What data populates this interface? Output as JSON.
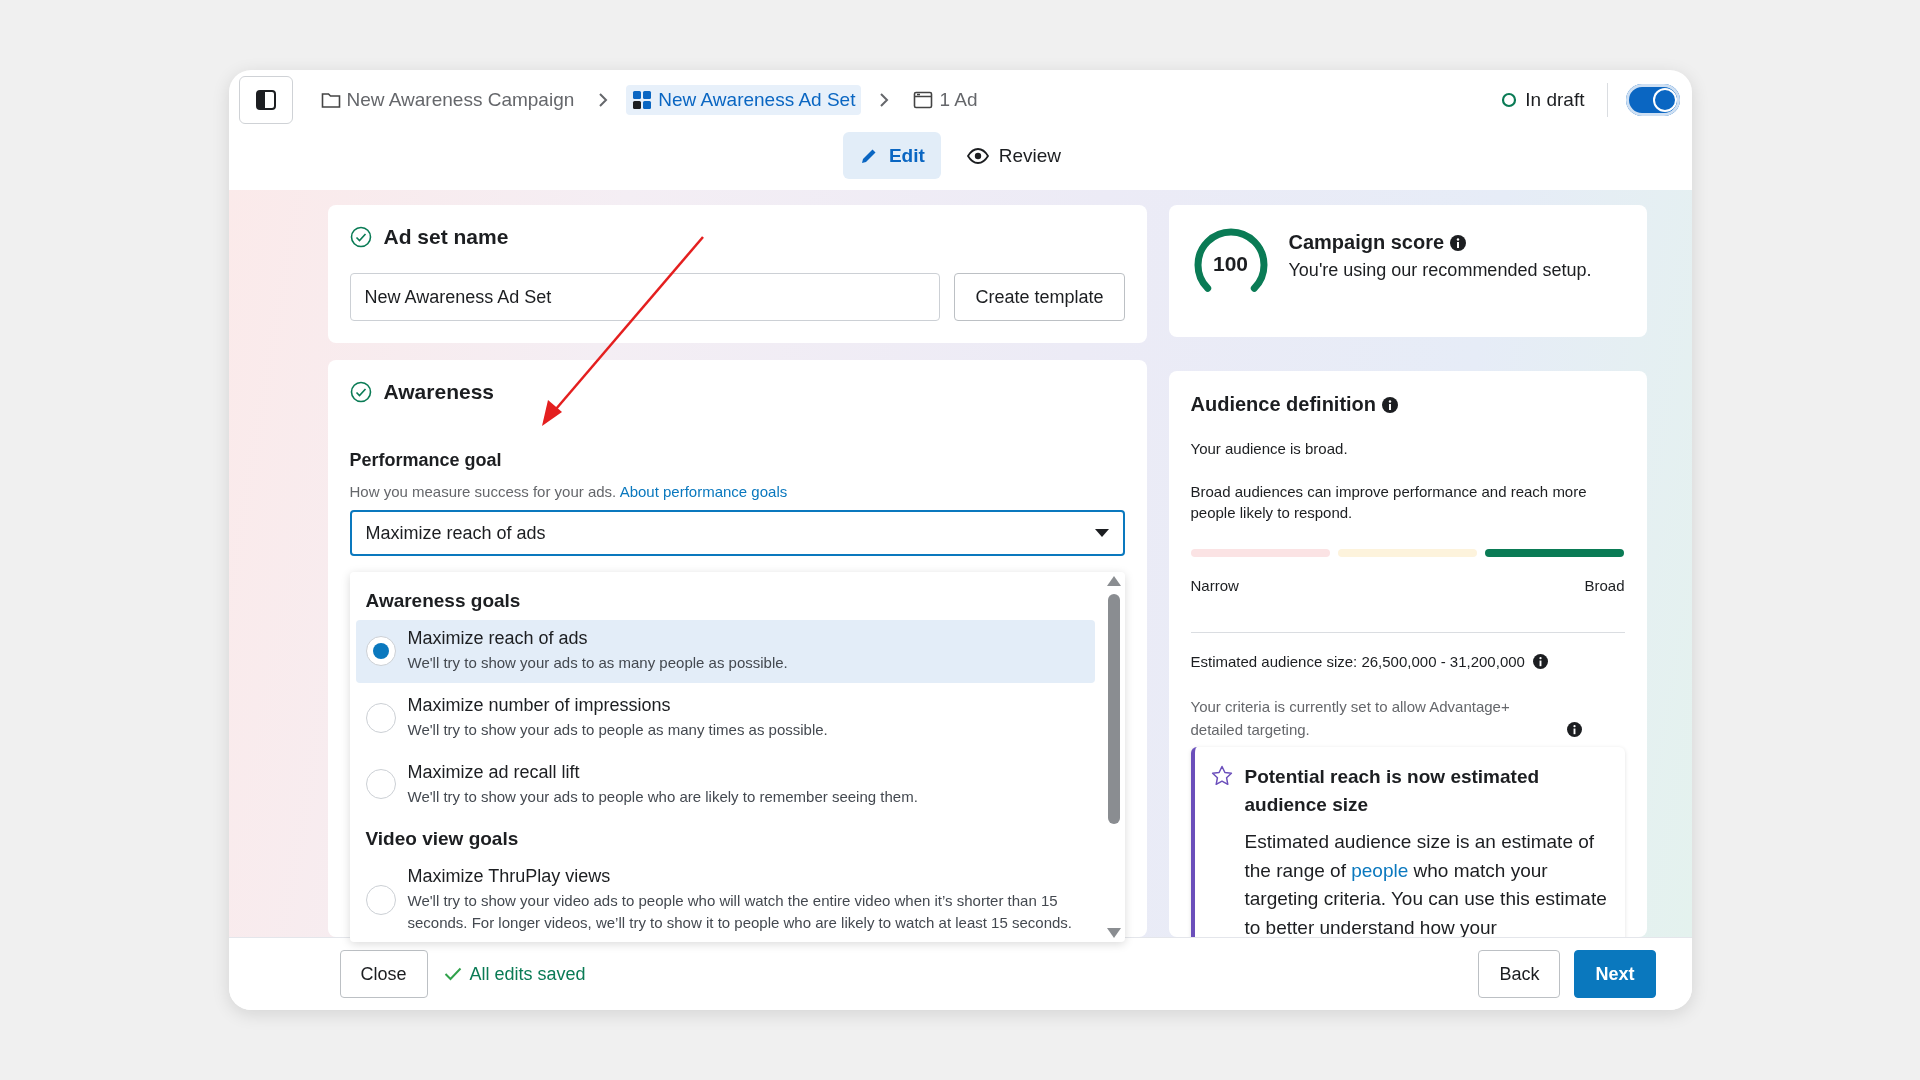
{
  "header": {
    "breadcrumbs": [
      {
        "label": "New Awareness Campaign",
        "kind": "folder",
        "selected": false
      },
      {
        "label": "New Awareness Ad Set",
        "kind": "adset",
        "selected": true
      },
      {
        "label": "1 Ad",
        "kind": "ad",
        "selected": false
      }
    ],
    "status": "In draft",
    "toggle": {
      "on": true
    }
  },
  "tabs": [
    {
      "label": "Edit",
      "kind": "edit",
      "selected": true
    },
    {
      "label": "Review",
      "kind": "review",
      "selected": false
    }
  ],
  "ad_set_name": {
    "title": "Ad set name",
    "complete": true,
    "value": "New Awareness Ad Set",
    "button": "Create template"
  },
  "objective": {
    "title": "Awareness",
    "complete": true,
    "performance_goal": {
      "label": "Performance goal",
      "hint": "How you measure success for your ads.",
      "link": "About performance goals",
      "value": "Maximize reach of ads"
    }
  },
  "goal_menu": {
    "groups": [
      {
        "title": "Awareness goals",
        "options": [
          {
            "title": "Maximize reach of ads",
            "description": "We'll try to show your ads to as many people as possible.",
            "selected": true
          },
          {
            "title": "Maximize number of impressions",
            "description": "We'll try to show your ads to people as many times as possible.",
            "selected": false
          },
          {
            "title": "Maximize ad recall lift",
            "description": "We'll try to show your ads to people who are likely to remember seeing them.",
            "selected": false
          }
        ]
      },
      {
        "title": "Video view goals",
        "options": [
          {
            "title": "Maximize ThruPlay views",
            "description": "We'll try to show your video ads to people who will watch the entire video when it’s shorter than 15 seconds. For longer videos, we’ll try to show it to people who are likely to watch at least 15 seconds.",
            "selected": false
          }
        ]
      }
    ]
  },
  "campaign_score": {
    "score": "100",
    "title": "Campaign score",
    "text": "You're using our recommended setup."
  },
  "audience": {
    "title": "Audience definition",
    "status": "Your audience is broad.",
    "text": "Broad audiences can improve performance and reach more people likely to respond.",
    "meter": [
      {
        "selected": false
      },
      {
        "selected": false
      },
      {
        "selected": true
      }
    ],
    "min_label": "Narrow",
    "max_label": "Broad",
    "estimate": "Estimated audience size: 26,500,000 - 31,200,000",
    "criteria": "Your criteria is currently set to allow Advantage+ detailed targeting.",
    "notice": {
      "title": "Potential reach is now estimated audience size",
      "text_before": "Estimated audience size is an estimate of the range of",
      "link": "people",
      "text_after": "who match your targeting criteria. You can use this estimate to better understand how your"
    }
  },
  "footer": {
    "close": "Close",
    "saved": "All edits saved",
    "back": "Back",
    "next": "Next"
  }
}
